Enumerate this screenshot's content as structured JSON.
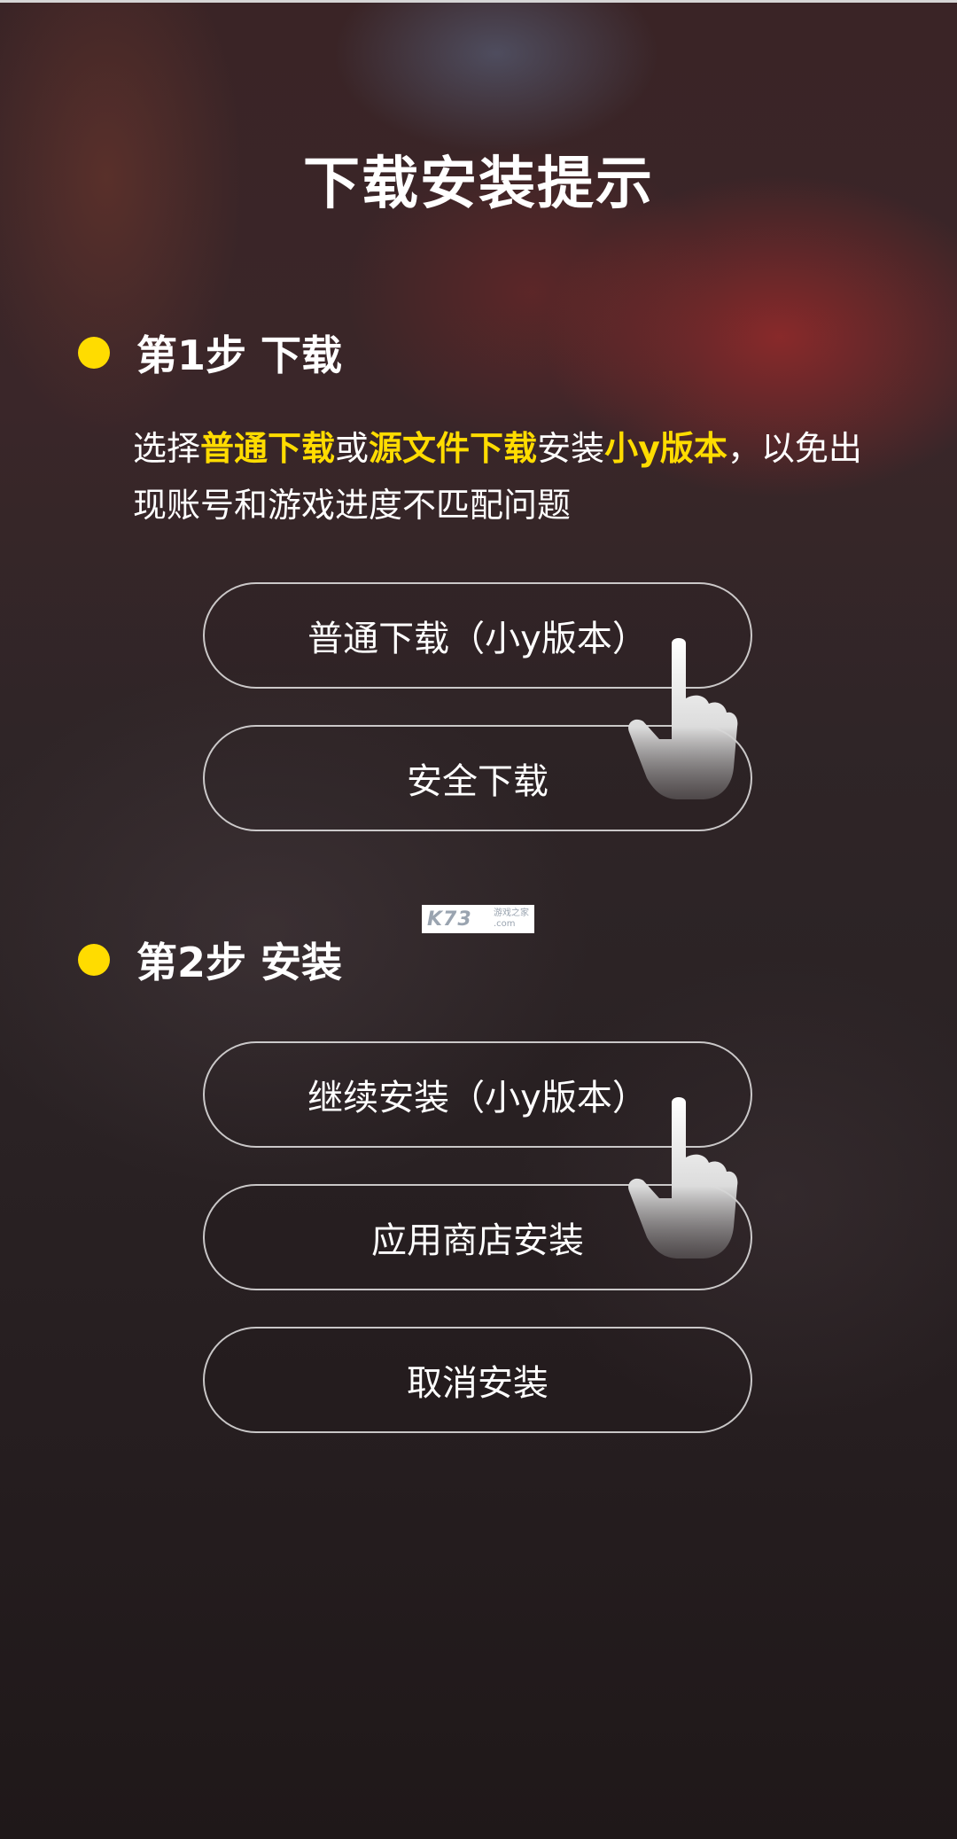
{
  "page": {
    "title": "下载安装提示"
  },
  "step1": {
    "title": "第1步 下载",
    "description": {
      "p1": "选择",
      "h1": "普通下载",
      "p2": "或",
      "h2": "源文件下载",
      "p3": "安装",
      "h3": "小y版本",
      "p4": "，以免出现账号和游戏进度不匹配问题"
    },
    "buttons": {
      "normal_download": "普通下载（小y版本）",
      "safe_download": "安全下载"
    }
  },
  "step2": {
    "title": "第2步 安装",
    "buttons": {
      "continue_install": "继续安装（小y版本）",
      "app_store_install": "应用商店安装",
      "cancel_install": "取消安装"
    }
  },
  "watermark": {
    "logo": "K73",
    "line1": "游戏之家",
    "line2": ".com"
  },
  "colors": {
    "accent": "#ffdc00",
    "text": "#ffffff",
    "button_border": "#ffffffbf"
  },
  "icons": {
    "step_marker": "yellow-dot",
    "pointer": "tap-hand-icon"
  }
}
